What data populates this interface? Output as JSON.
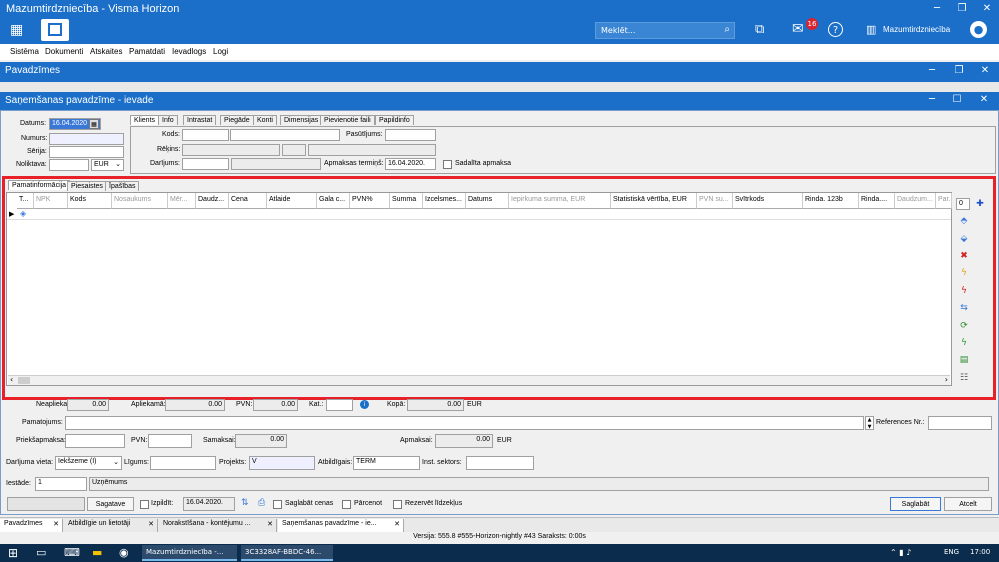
{
  "window": {
    "title": "Mazumtirdzniecība - Visma Horizon",
    "search_placeholder": "Meklēt...",
    "mail_badge": "16",
    "user": "Mazumtirdzniecība"
  },
  "menu": [
    "Sistēma",
    "Dokumenti",
    "Atskaites",
    "Pamatdati",
    "Ievadlogs",
    "Logi"
  ],
  "pav_title": "Pavadzīmes",
  "dialog": {
    "title": "Saņemšanas pavadzīme - ievade",
    "left": {
      "datums_label": "Datums:",
      "datums_value": "16.04.2020",
      "numurs_label": "Numurs:",
      "serija_label": "Sērija:",
      "noliktava_label": "Noliktava:",
      "currency": "EUR"
    },
    "tabs": [
      "Klients",
      "Info",
      "Intrastat",
      "Piegāde",
      "Konti",
      "Dimensijas",
      "Pievienotie faili",
      "Papildinfo"
    ],
    "right": {
      "kods_label": "Kods:",
      "pasutijums_label": "Pasūtījums:",
      "rekins_label": "Rēķins:",
      "darijums_label": "Darījums:",
      "apmaksas_label": "Apmaksas termiņš:",
      "apmaksas_value": "16.04.2020.",
      "sadalita_label": "Sadalīta apmaksa"
    },
    "lower_tabs": [
      "Pamatinformācija",
      "Piesaistes",
      "Īpašības"
    ],
    "grid_headers": [
      "T...",
      "NPK",
      "Kods",
      "Nosaukums",
      "Mēr...",
      "Daudz...",
      "Cena",
      "Atlaide",
      "Gala c...",
      "PVN%",
      "Summa",
      "Izcelsmes...",
      "Datums",
      "Iepirkuma summa, EUR",
      "Statistiskā vērtība, EUR",
      "PVN su...",
      "Svītrkods",
      "Rinda. 123b",
      "Rinda....",
      "Daudzum...",
      "Par..."
    ],
    "page_counter": "0",
    "totals": {
      "neapliekama_label": "Neapliekamā:",
      "neapliekama_value": "0.00",
      "apliekama_label": "Apliekamā:",
      "apliekama_value": "0.00",
      "pvn_label": "PVN:",
      "pvn_value": "0.00",
      "kat_label": "Kat.:",
      "kopa_label": "Kopā:",
      "kopa_value": "0.00",
      "currency": "EUR"
    },
    "pamatojums_label": "Pamatojums:",
    "references_label": "References Nr.:",
    "priekapmaksa_label": "Priekšapmaksa:",
    "pvn2_label": "PVN:",
    "samaksai_label": "Samaksai:",
    "samaksai_value": "0.00",
    "apmaksai_label": "Apmaksai:",
    "apmaksai_value": "0.00",
    "currency2": "EUR",
    "darijuma_vieta_label": "Darījuma vieta:",
    "darijuma_vieta_value": "Iekšzeme (I)",
    "ligums_label": "Līgums:",
    "projekts_label": "Projekts:",
    "projekts_value": "V",
    "atbildigais_label": "Atbildīgais:",
    "atbildigais_value": "TERM",
    "inst_label": "Inst. sektors:",
    "iestade_label": "Iestāde:",
    "iestade_value": "1",
    "iestade_name": "Uzņēmums",
    "sagatave": "Sagatave",
    "izpildit": "Izpildīt:",
    "izpildit_date": "16.04.2020.",
    "saglabat_cenas": "Saglabāt cenas",
    "parcenot": "Pārcenot",
    "rezervet": "Rezervēt līdzekļus",
    "saglabat": "Saglabāt",
    "atcelt": "Atcelt"
  },
  "doc_tabs": [
    "Pavadzīmes",
    "Atbildīgie un lietotāji",
    "Norakstīšana - kontējumu ...",
    "Saņemšanas pavadzīme - ie..."
  ],
  "status": "Versija: 555.8 #555-Horizon-nightly #43  Saraksts: 0:00s",
  "taskbar": {
    "app1": "Mazumtirdzniecība -...",
    "app2": "3C3328AF-BBDC-46...",
    "lang": "ENG",
    "time": "17:00"
  }
}
